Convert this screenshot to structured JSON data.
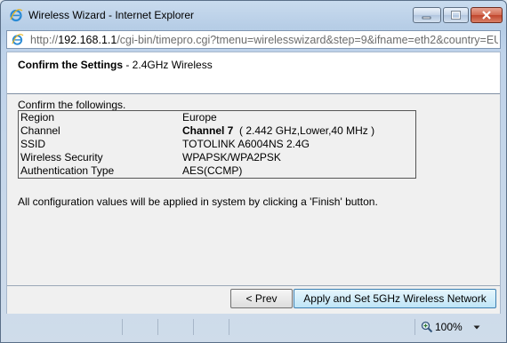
{
  "window": {
    "title": "Wireless Wizard - Internet Explorer"
  },
  "address": {
    "scheme": "http://",
    "host": "192.168.1.1",
    "path": "/cgi-bin/timepro.cgi?tmenu=wirelesswizard&step=9&ifname=eth2&country=EU"
  },
  "header": {
    "title_bold": "Confirm the Settings",
    "title_rest": " - 2.4GHz Wireless"
  },
  "intro": "Confirm the followings.",
  "settings": [
    {
      "label": "Region",
      "value": "Europe",
      "value_bold": ""
    },
    {
      "label": "Channel",
      "value_bold": "Channel 7",
      "value": "  ( 2.442 GHz,Lower,40 MHz )"
    },
    {
      "label": "SSID",
      "value": "TOTOLINK A6004NS 2.4G",
      "value_bold": ""
    },
    {
      "label": "Wireless Security",
      "value": "WPAPSK/WPA2PSK",
      "value_bold": ""
    },
    {
      "label": "Authentication Type",
      "value": "AES(CCMP)",
      "value_bold": ""
    }
  ],
  "note": "All configuration values will be applied in system by clicking a 'Finish' button.",
  "buttons": {
    "prev": "< Prev",
    "next": "Apply and Set 5GHz Wireless Network"
  },
  "status": {
    "zoom": "100%"
  },
  "icons": {
    "browser": "ie-icon",
    "zoom": "zoom-icon",
    "dropdown": "chevron-down-icon"
  }
}
